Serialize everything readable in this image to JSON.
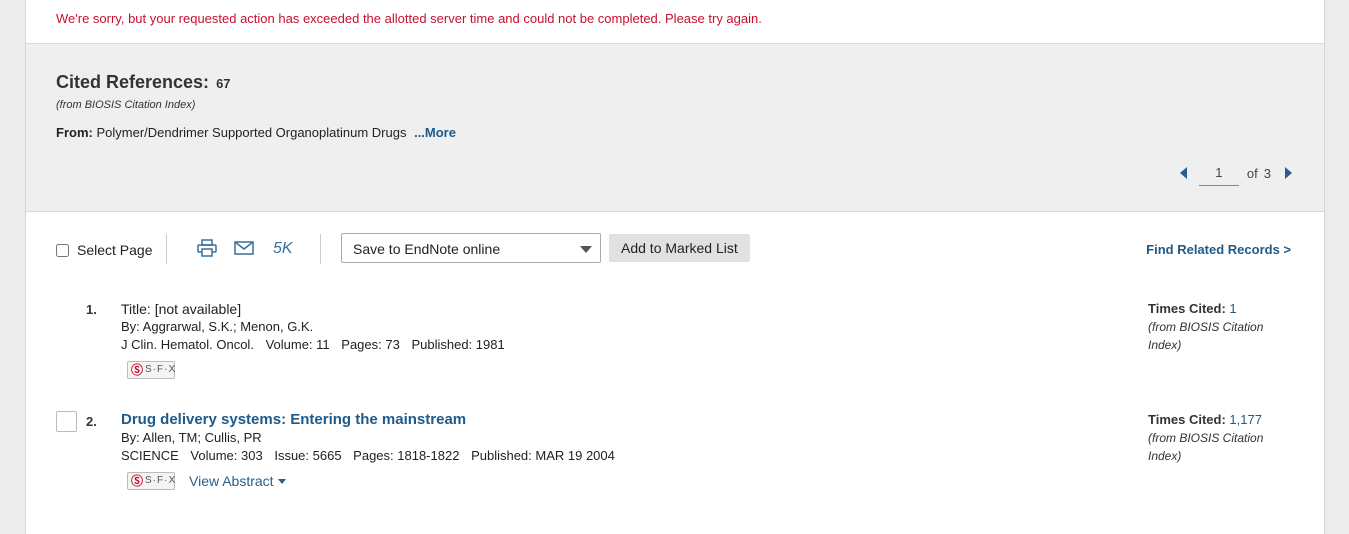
{
  "error_message": "We're sorry, but your requested action has exceeded the allotted server time and could not be completed. Please try again.",
  "summary": {
    "title": "Cited References:",
    "count": "67",
    "source": "(from BIOSIS Citation Index)",
    "from_label": "From:",
    "from_value": "Polymer/Dendrimer Supported Organoplatinum Drugs",
    "more_link": "...More"
  },
  "pager": {
    "current_page": "1",
    "of_label": "of",
    "total_pages": "3"
  },
  "toolbar": {
    "select_page_label": "Select Page",
    "fivek_label": "5K",
    "save_option": "Save to EndNote online",
    "add_marked_label": "Add to Marked List",
    "find_related_label": "Find Related Records >"
  },
  "records": [
    {
      "number": "1.",
      "title": "Title: [not available]",
      "authors": "By: Aggrarwal, S.K.; Menon, G.K.",
      "journal": "J Clin. Hematol. Oncol.",
      "volume": "Volume: 11",
      "pages": "Pages: 73",
      "published": "Published: 1981",
      "sfx_label": "S·F·X",
      "times_cited_label": "Times Cited:",
      "times_cited": "1",
      "cited_source": "(from BIOSIS Citation Index)"
    },
    {
      "number": "2.",
      "title": "Drug delivery systems: Entering the mainstream",
      "authors": "By: Allen, TM; Cullis, PR",
      "journal": "SCIENCE",
      "volume": "Volume: 303",
      "issue": "Issue: 5665",
      "pages": "Pages: 1818-1822",
      "published": "Published: MAR 19 2004",
      "sfx_label": "S·F·X",
      "view_abstract": "View Abstract",
      "times_cited_label": "Times Cited:",
      "times_cited": "1,177",
      "cited_source": "(from BIOSIS Citation Index)"
    }
  ],
  "colors": {
    "error": "#c8102e",
    "link": "#1e5a8a",
    "summary_bg": "#efefef"
  },
  "icons": [
    "print-icon",
    "email-icon",
    "caret-down-icon",
    "arrow-left-icon",
    "arrow-right-icon",
    "sfx-icon"
  ]
}
